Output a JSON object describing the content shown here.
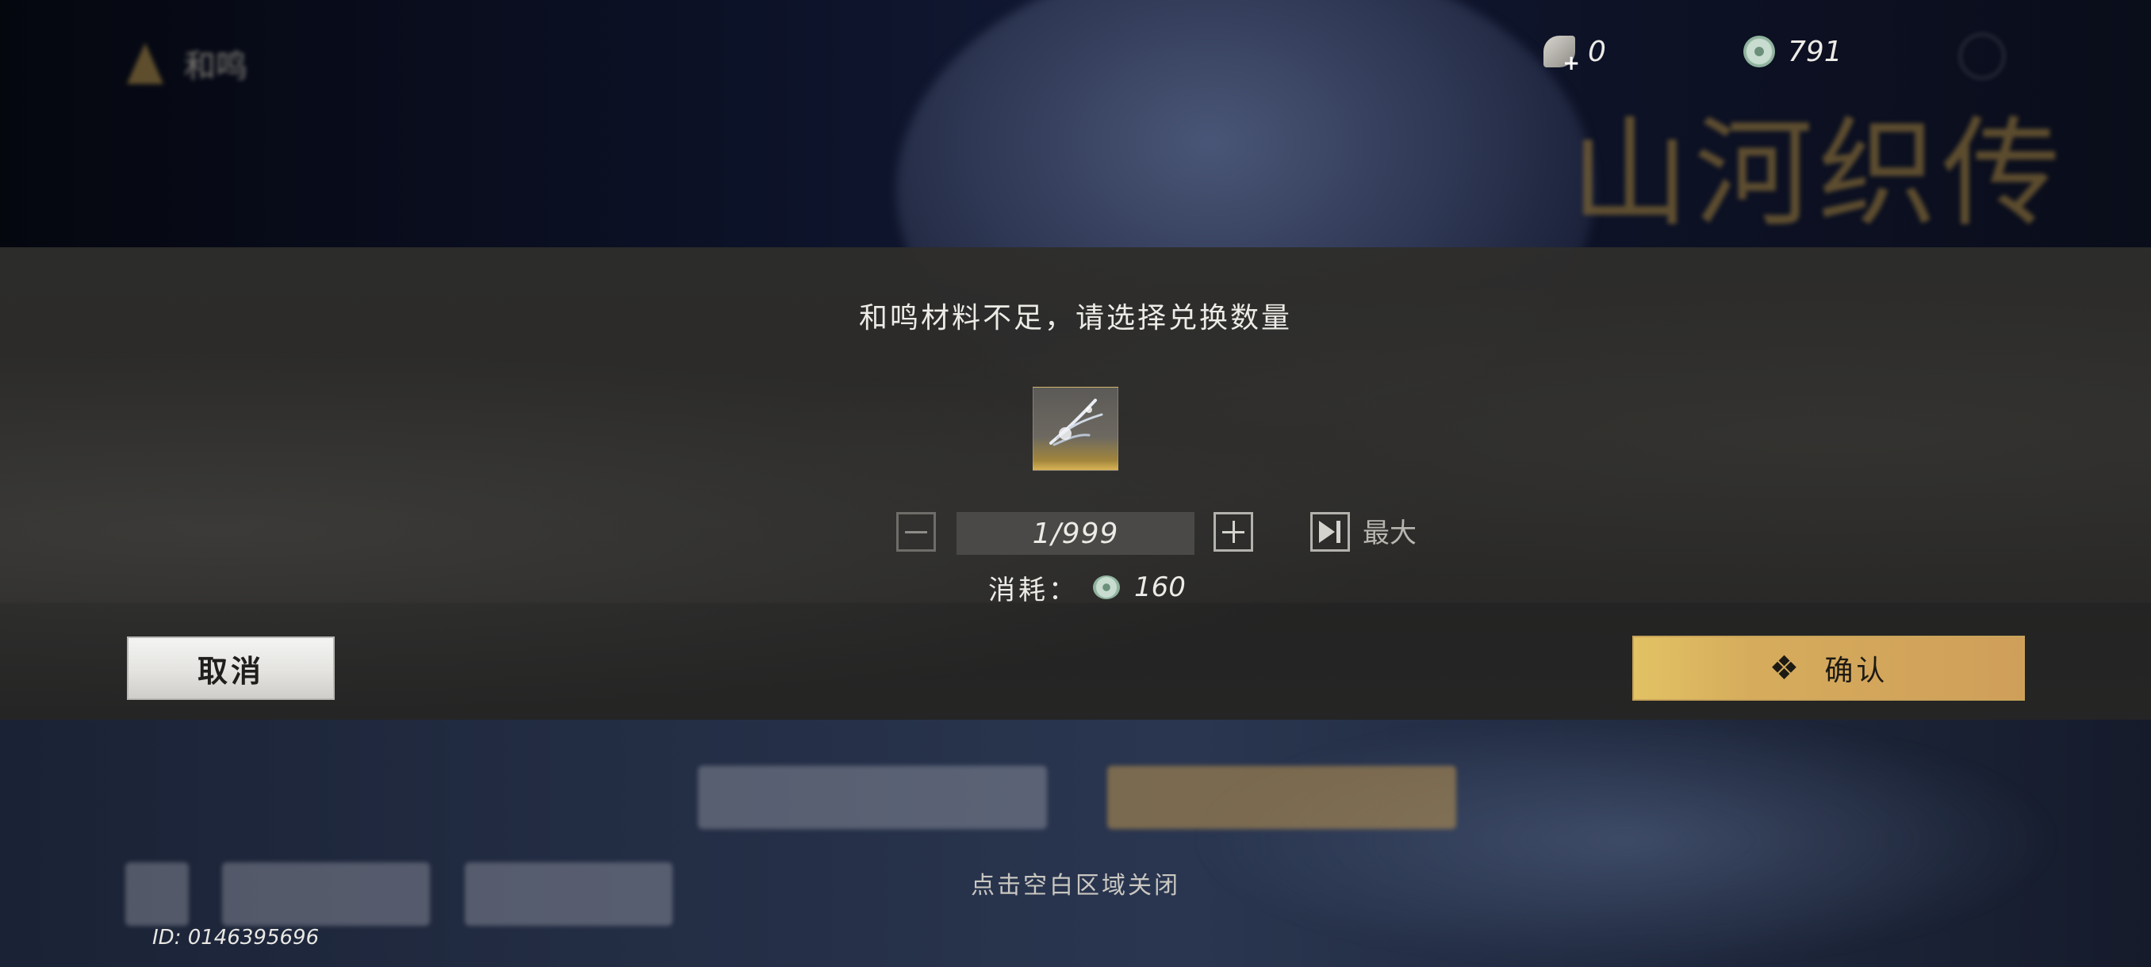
{
  "hud": {
    "player_name": "和鸣",
    "feather_currency": "0",
    "jade_currency": "791"
  },
  "background": {
    "calligraphy": "山河织传"
  },
  "dialog": {
    "title": "和鸣材料不足，请选择兑换数量",
    "item_icon": "feather-material-icon",
    "quantity": "1/999",
    "max_label": "最大",
    "cost_label": "消耗：",
    "cost_value": "160",
    "cancel_label": "取消",
    "confirm_label": "确认",
    "confirm_icon": "❖"
  },
  "footer": {
    "close_hint": "点击空白区域关闭",
    "player_id": "ID: 0146395696"
  }
}
